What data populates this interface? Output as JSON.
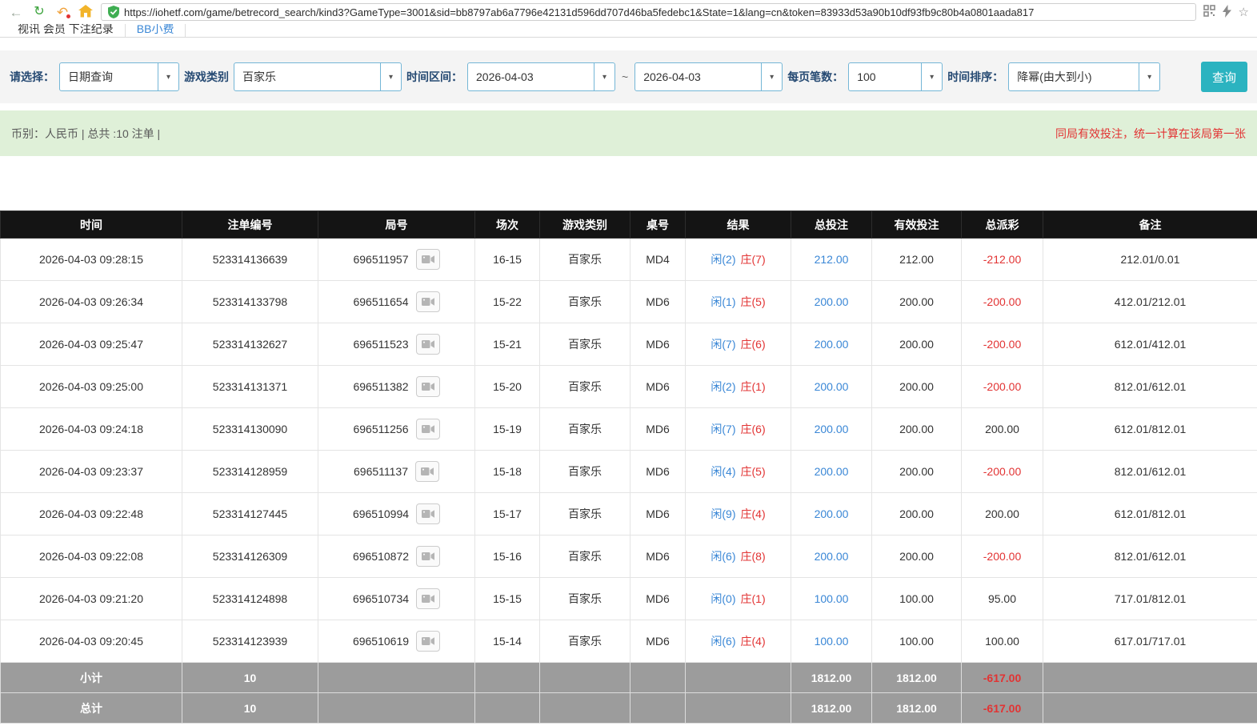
{
  "colors": {
    "accent": "#2bb3c0",
    "link": "#3a87d6",
    "red": "#e23333",
    "label": "#264a73",
    "summary_bg": "#dff0d8",
    "header_bg": "#141414",
    "footer_bg": "#9c9c9c",
    "border_blue": "#74b6d6"
  },
  "browser": {
    "url": "https://iohetf.com/game/betrecord_search/kind3?GameType=3001&sid=bb8797ab6a7796e42131d596dd707d46ba5fedebc1&State=1&lang=cn&token=83933d53a90b10df93fb9c80b4a0801aada817",
    "icons": {
      "back": "←",
      "refresh": "↻",
      "undo": "↶",
      "home": "home-icon",
      "shield": "secure-shield-icon",
      "qr": "qr-code-icon",
      "bolt": "lightning-icon",
      "star": "☆",
      "caret": "▾"
    }
  },
  "tabs": {
    "main": "视讯 会员 下注纪录",
    "bb": "BB小费"
  },
  "filters": {
    "select_label": "请选择：",
    "date_query_value": "日期查询",
    "game_type_label": "游戏类别",
    "game_type_value": "百家乐",
    "time_range_label": "时间区间：",
    "date_from": "2026-04-03",
    "tilde": "~",
    "date_to": "2026-04-03",
    "per_page_label": "每页笔数：",
    "per_page_value": "100",
    "sort_label": "时间排序：",
    "sort_value": "降幂(由大到小)",
    "search_button": "查询"
  },
  "summary": {
    "left": "币别：人民币 | 总共 :10 注单 |",
    "right": "同局有效投注，统一计算在该局第一张"
  },
  "table": {
    "headers": [
      "时间",
      "注单编号",
      "局号",
      "场次",
      "游戏类别",
      "桌号",
      "结果",
      "总投注",
      "有效投注",
      "总派彩",
      "备注"
    ],
    "rows": [
      {
        "time": "2026-04-03 09:28:15",
        "bet_no": "523314136639",
        "round_no": "696511957",
        "session": "16-15",
        "game": "百家乐",
        "table_no": "MD4",
        "player": "闲(2)",
        "banker": "庄(7)",
        "total_bet": "212.00",
        "valid_bet": "212.00",
        "payout": "-212.00",
        "remark": "212.01/0.01"
      },
      {
        "time": "2026-04-03 09:26:34",
        "bet_no": "523314133798",
        "round_no": "696511654",
        "session": "15-22",
        "game": "百家乐",
        "table_no": "MD6",
        "player": "闲(1)",
        "banker": "庄(5)",
        "total_bet": "200.00",
        "valid_bet": "200.00",
        "payout": "-200.00",
        "remark": "412.01/212.01"
      },
      {
        "time": "2026-04-03 09:25:47",
        "bet_no": "523314132627",
        "round_no": "696511523",
        "session": "15-21",
        "game": "百家乐",
        "table_no": "MD6",
        "player": "闲(7)",
        "banker": "庄(6)",
        "total_bet": "200.00",
        "valid_bet": "200.00",
        "payout": "-200.00",
        "remark": "612.01/412.01"
      },
      {
        "time": "2026-04-03 09:25:00",
        "bet_no": "523314131371",
        "round_no": "696511382",
        "session": "15-20",
        "game": "百家乐",
        "table_no": "MD6",
        "player": "闲(2)",
        "banker": "庄(1)",
        "total_bet": "200.00",
        "valid_bet": "200.00",
        "payout": "-200.00",
        "remark": "812.01/612.01"
      },
      {
        "time": "2026-04-03 09:24:18",
        "bet_no": "523314130090",
        "round_no": "696511256",
        "session": "15-19",
        "game": "百家乐",
        "table_no": "MD6",
        "player": "闲(7)",
        "banker": "庄(6)",
        "total_bet": "200.00",
        "valid_bet": "200.00",
        "payout": "200.00",
        "remark": "612.01/812.01"
      },
      {
        "time": "2026-04-03 09:23:37",
        "bet_no": "523314128959",
        "round_no": "696511137",
        "session": "15-18",
        "game": "百家乐",
        "table_no": "MD6",
        "player": "闲(4)",
        "banker": "庄(5)",
        "total_bet": "200.00",
        "valid_bet": "200.00",
        "payout": "-200.00",
        "remark": "812.01/612.01"
      },
      {
        "time": "2026-04-03 09:22:48",
        "bet_no": "523314127445",
        "round_no": "696510994",
        "session": "15-17",
        "game": "百家乐",
        "table_no": "MD6",
        "player": "闲(9)",
        "banker": "庄(4)",
        "total_bet": "200.00",
        "valid_bet": "200.00",
        "payout": "200.00",
        "remark": "612.01/812.01"
      },
      {
        "time": "2026-04-03 09:22:08",
        "bet_no": "523314126309",
        "round_no": "696510872",
        "session": "15-16",
        "game": "百家乐",
        "table_no": "MD6",
        "player": "闲(6)",
        "banker": "庄(8)",
        "total_bet": "200.00",
        "valid_bet": "200.00",
        "payout": "-200.00",
        "remark": "812.01/612.01"
      },
      {
        "time": "2026-04-03 09:21:20",
        "bet_no": "523314124898",
        "round_no": "696510734",
        "session": "15-15",
        "game": "百家乐",
        "table_no": "MD6",
        "player": "闲(0)",
        "banker": "庄(1)",
        "total_bet": "100.00",
        "valid_bet": "100.00",
        "payout": "95.00",
        "remark": "717.01/812.01"
      },
      {
        "time": "2026-04-03 09:20:45",
        "bet_no": "523314123939",
        "round_no": "696510619",
        "session": "15-14",
        "game": "百家乐",
        "table_no": "MD6",
        "player": "闲(6)",
        "banker": "庄(4)",
        "total_bet": "100.00",
        "valid_bet": "100.00",
        "payout": "100.00",
        "remark": "617.01/717.01"
      }
    ],
    "subtotal": {
      "label": "小计",
      "count": "10",
      "total_bet": "1812.00",
      "valid_bet": "1812.00",
      "payout": "-617.00"
    },
    "total": {
      "label": "总计",
      "count": "10",
      "total_bet": "1812.00",
      "valid_bet": "1812.00",
      "payout": "-617.00"
    }
  }
}
